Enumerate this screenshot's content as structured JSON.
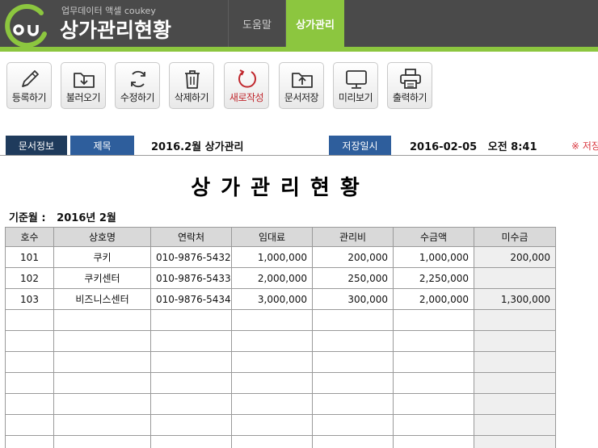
{
  "header": {
    "subtitle": "업무데이터 액셀 coukey",
    "title": "상가관리현황",
    "tabs": [
      {
        "label": "도움말",
        "active": false
      },
      {
        "label": "상가관리",
        "active": true
      }
    ],
    "colors": {
      "bar": "#4a4a4a",
      "accent": "#8cc63f"
    }
  },
  "toolbar": {
    "buttons": [
      {
        "label": "등록하기",
        "icon": "pencil-icon"
      },
      {
        "label": "불러오기",
        "icon": "folder-download-icon"
      },
      {
        "label": "수정하기",
        "icon": "refresh-icon"
      },
      {
        "label": "삭제하기",
        "icon": "trash-icon"
      },
      {
        "label": "새로작성",
        "icon": "new-circle-icon",
        "color": "#c0272d"
      },
      {
        "label": "문서저장",
        "icon": "folder-upload-icon"
      },
      {
        "label": "미리보기",
        "icon": "monitor-icon"
      },
      {
        "label": "출력하기",
        "icon": "printer-icon"
      }
    ]
  },
  "info": {
    "doc_info_label": "문서정보",
    "title_label": "제목",
    "title_value": "2016.2월 상가관리",
    "save_label": "저장일시",
    "save_value": "2016-02-05   오전 8:41",
    "note": "※ 저장"
  },
  "document": {
    "title": "상가관리현황",
    "month_label": "기준월 :   2016년 2월"
  },
  "table": {
    "headers": [
      "호수",
      "상호명",
      "연락처",
      "임대료",
      "관리비",
      "수금액",
      "미수금"
    ],
    "rows": [
      [
        "101",
        "쿠키",
        "010-9876-5432",
        "1,000,000",
        "200,000",
        "1,000,000",
        "200,000"
      ],
      [
        "102",
        "쿠키센터",
        "010-9876-5433",
        "2,000,000",
        "250,000",
        "2,250,000",
        ""
      ],
      [
        "103",
        "비즈니스센터",
        "010-9876-5434",
        "3,000,000",
        "300,000",
        "2,000,000",
        "1,300,000"
      ],
      [
        "",
        "",
        "",
        "",
        "",
        "",
        ""
      ],
      [
        "",
        "",
        "",
        "",
        "",
        "",
        ""
      ],
      [
        "",
        "",
        "",
        "",
        "",
        "",
        ""
      ],
      [
        "",
        "",
        "",
        "",
        "",
        "",
        ""
      ],
      [
        "",
        "",
        "",
        "",
        "",
        "",
        ""
      ],
      [
        "",
        "",
        "",
        "",
        "",
        "",
        ""
      ],
      [
        "",
        "",
        "",
        "",
        "",
        "",
        ""
      ]
    ]
  }
}
